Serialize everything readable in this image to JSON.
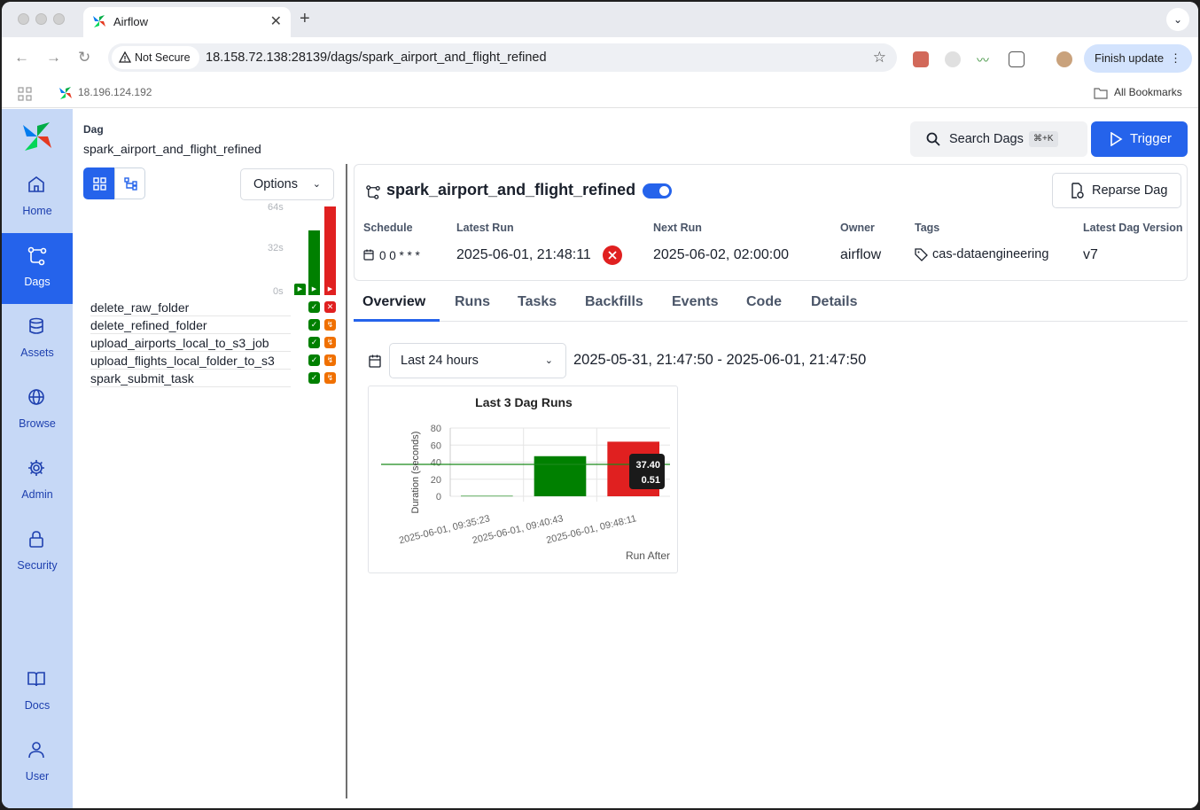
{
  "browser": {
    "tab_title": "Airflow",
    "security_label": "Not Secure",
    "url": "18.158.72.138:28139/dags/spark_airport_and_flight_refined",
    "finish_update": "Finish update",
    "bookmark_item": "18.196.124.192",
    "all_bookmarks": "All Bookmarks"
  },
  "sidebar": {
    "items": [
      {
        "label": "Home",
        "icon": "home-icon"
      },
      {
        "label": "Dags",
        "icon": "dags-icon",
        "active": true
      },
      {
        "label": "Assets",
        "icon": "database-icon"
      },
      {
        "label": "Browse",
        "icon": "globe-icon"
      },
      {
        "label": "Admin",
        "icon": "gear-icon"
      },
      {
        "label": "Security",
        "icon": "lock-icon"
      },
      {
        "label": "Docs",
        "icon": "book-icon"
      },
      {
        "label": "User",
        "icon": "user-icon"
      }
    ]
  },
  "header": {
    "breadcrumb_key": "Dag",
    "breadcrumb_value": "spark_airport_and_flight_refined",
    "search_label": "Search Dags",
    "search_shortcut": "⌘+K",
    "trigger_label": "Trigger"
  },
  "grid": {
    "options_label": "Options",
    "y_ticks": [
      "64s",
      "32s",
      "0s"
    ],
    "run_durations": [
      0.51,
      47.0,
      64.0
    ],
    "run_states": [
      "success",
      "success",
      "failed"
    ],
    "tasks": [
      {
        "name": "delete_raw_folder",
        "states": [
          "success",
          "failed"
        ]
      },
      {
        "name": "delete_refined_folder",
        "states": [
          "success",
          "upstream_failed"
        ]
      },
      {
        "name": "upload_airports_local_to_s3_job",
        "states": [
          "success",
          "upstream_failed"
        ]
      },
      {
        "name": "upload_flights_local_folder_to_s3",
        "states": [
          "success",
          "upstream_failed"
        ]
      },
      {
        "name": "spark_submit_task",
        "states": [
          "success",
          "upstream_failed"
        ]
      }
    ]
  },
  "dag": {
    "title": "spark_airport_and_flight_refined",
    "paused": false,
    "reparse_label": "Reparse Dag",
    "meta": {
      "schedule_label": "Schedule",
      "schedule_value": "0 0 * * *",
      "latest_run_label": "Latest Run",
      "latest_run_value": "2025-06-01, 21:48:11",
      "next_run_label": "Next Run",
      "next_run_value": "2025-06-02, 02:00:00",
      "owner_label": "Owner",
      "owner_value": "airflow",
      "tags_label": "Tags",
      "tags_value": "cas-dataengineering",
      "version_label": "Latest Dag Version",
      "version_value": "v7"
    }
  },
  "tabs": [
    "Overview",
    "Runs",
    "Tasks",
    "Backfills",
    "Events",
    "Code",
    "Details"
  ],
  "overview": {
    "range_label": "Last 24 hours",
    "range_text": "2025-05-31, 21:47:50 - 2025-06-01, 21:47:50"
  },
  "colors": {
    "accent": "#2563eb",
    "success": "#008000",
    "failed": "#e02020",
    "upstream_failed": "#f07000"
  },
  "chart_data": {
    "type": "bar",
    "title": "Last 3 Dag Runs",
    "xlabel": "Run After",
    "ylabel": "Duration (seconds)",
    "categories": [
      "2025-06-01, 09:35:23",
      "2025-06-01, 09:40:43",
      "2025-06-01, 09:48:11"
    ],
    "values": [
      0.51,
      47.0,
      64.0
    ],
    "bar_colors": [
      "#008000",
      "#008000",
      "#e02020"
    ],
    "ylim": [
      0,
      80
    ],
    "yticks": [
      0,
      20,
      40,
      60,
      80
    ],
    "mean_line": 37.4,
    "tooltip": [
      "37.40",
      "0.51"
    ],
    "grid": true
  }
}
